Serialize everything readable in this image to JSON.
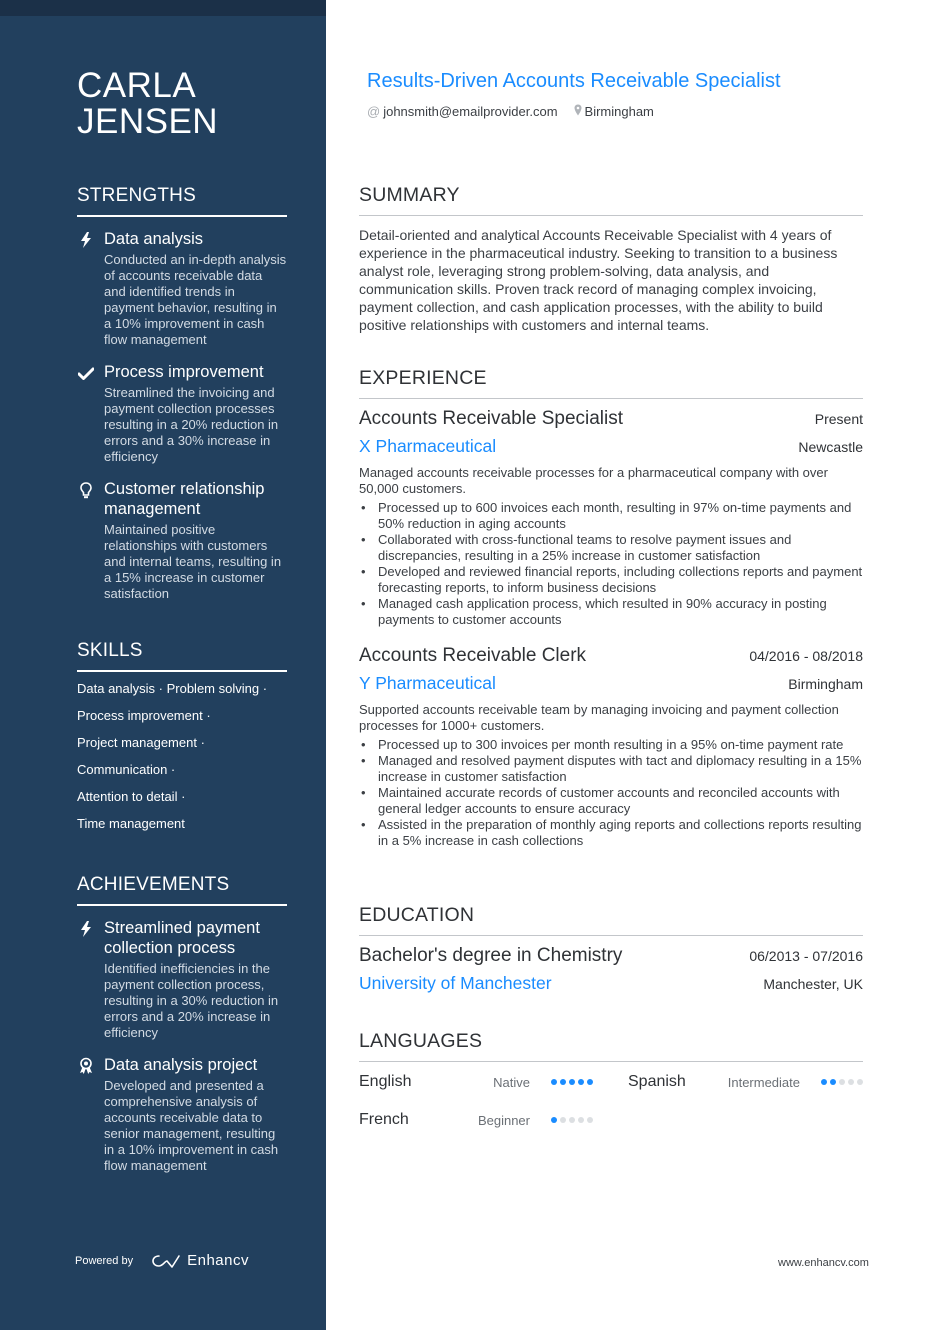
{
  "name": {
    "line1": "CARLA",
    "line2": "JENSEN"
  },
  "headline": "Results-Driven Accounts Receivable Specialist",
  "contact": {
    "email": "johnsmith@emailprovider.com",
    "email_icon": "at-icon",
    "location": "Birmingham",
    "location_icon": "map-pin-icon"
  },
  "sidebar": {
    "strengths": {
      "title": "STRENGTHS",
      "items": [
        {
          "icon": "lightning-icon",
          "title": "Data analysis",
          "desc": "Conducted an in-depth analysis of accounts receivable data and identified trends in payment behavior, resulting in a 10% improvement in cash flow management"
        },
        {
          "icon": "checkmark-icon",
          "title": "Process improvement",
          "desc": "Streamlined the invoicing and payment collection processes resulting in a 20% reduction in errors and a 30% increase in efficiency"
        },
        {
          "icon": "lightbulb-icon",
          "title": "Customer relationship management",
          "desc": "Maintained positive relationships with customers and internal teams, resulting in a 15% increase in customer satisfaction"
        }
      ]
    },
    "skills": {
      "title": "SKILLS",
      "lines": [
        "Data analysis · Problem solving ·",
        "Process improvement ·",
        "Project management ·",
        "Communication ·",
        "Attention to detail ·",
        "Time management"
      ]
    },
    "achievements": {
      "title": "ACHIEVEMENTS",
      "items": [
        {
          "icon": "lightning-icon",
          "title": "Streamlined payment collection process",
          "desc": "Identified inefficiencies in the payment collection process, resulting in a 30% reduction in errors and a 20% increase in efficiency"
        },
        {
          "icon": "award-medal-icon",
          "title": "Data analysis project",
          "desc": "Developed and presented a comprehensive analysis of accounts receivable data to senior management, resulting in a 10% improvement in cash flow management"
        }
      ]
    },
    "powered_by": "Powered by",
    "brand": "Enhancv"
  },
  "summary": {
    "title": "SUMMARY",
    "text": "Detail-oriented and analytical Accounts Receivable Specialist with 4 years of experience in the pharmaceutical industry. Seeking to transition to a business analyst role, leveraging strong problem-solving, data analysis, and communication skills. Proven track record of managing complex invoicing, payment collection, and cash application processes, with the ability to build positive relationships with customers and internal teams."
  },
  "experience": {
    "title": "EXPERIENCE",
    "jobs": [
      {
        "role": "Accounts Receivable Specialist",
        "date": "Present",
        "company": "X Pharmaceutical",
        "location": "Newcastle",
        "desc": "Managed accounts receivable processes for a pharmaceutical company with over 50,000 customers.",
        "bullets": [
          "Processed up to 600 invoices each month, resulting in 97% on-time payments and 50% reduction in aging accounts",
          "Collaborated with cross-functional teams to resolve payment issues and discrepancies, resulting in a 25% increase in customer satisfaction",
          "Developed and reviewed financial reports, including collections reports and payment forecasting reports, to inform business decisions",
          "Managed cash application process, which resulted in 90% accuracy in posting payments to customer accounts"
        ]
      },
      {
        "role": "Accounts Receivable Clerk",
        "date": "04/2016 - 08/2018",
        "company": "Y Pharmaceutical",
        "location": "Birmingham",
        "desc": "Supported accounts receivable team by managing invoicing and payment collection processes for 1000+ customers.",
        "bullets": [
          "Processed up to 300 invoices per month resulting in a 95% on-time payment rate",
          "Managed and resolved payment disputes with tact and diplomacy resulting in a 15% increase in customer satisfaction",
          "Maintained accurate records of customer accounts and reconciled accounts with general ledger accounts to ensure accuracy",
          "Assisted in the preparation of monthly aging reports and collections reports resulting in a 5% increase in cash collections"
        ]
      }
    ]
  },
  "education": {
    "title": "EDUCATION",
    "degree": "Bachelor's degree in Chemistry",
    "date": "06/2013 - 07/2016",
    "school": "University of Manchester",
    "location": "Manchester, UK"
  },
  "languages": {
    "title": "LANGUAGES",
    "items": [
      {
        "name": "English",
        "level": "Native",
        "rating": 5,
        "max": 5
      },
      {
        "name": "Spanish",
        "level": "Intermediate",
        "rating": 2,
        "max": 5
      },
      {
        "name": "French",
        "level": "Beginner",
        "rating": 1,
        "max": 5
      }
    ]
  },
  "footer_url": "www.enhancv.com",
  "colors": {
    "sidebar_bg": "#22405e",
    "accent": "#1a8cff",
    "text": "#2f3236"
  }
}
